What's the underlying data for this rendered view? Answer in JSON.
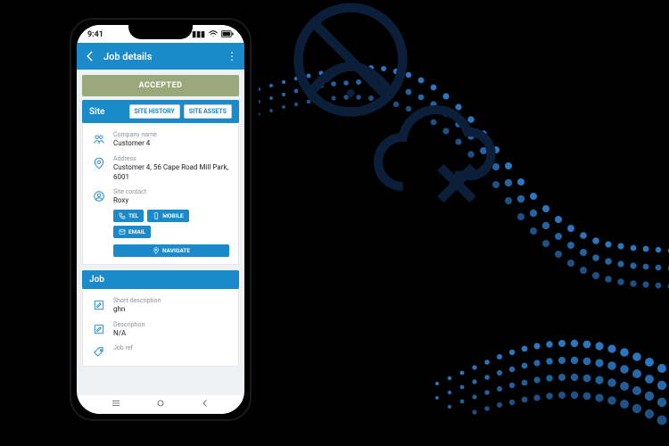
{
  "colors": {
    "primary": "#1a8acb",
    "accepted": "#9aa97c",
    "icon_dark": "#0b1f3a"
  },
  "status_bar": {
    "time": "9:41"
  },
  "header": {
    "title": "Job details"
  },
  "job_status": {
    "label": "ACCEPTED"
  },
  "site": {
    "section_label": "Site",
    "buttons": {
      "history": "SITE HISTORY",
      "assets": "SITE ASSETS"
    },
    "company": {
      "label": "Company name",
      "value": "Customer 4"
    },
    "address": {
      "label": "Address",
      "value": "Customer 4, 56 Cape Road Mill Park, 6001"
    },
    "contact": {
      "label": "Site contact",
      "value": "Roxy"
    },
    "actions": {
      "tel": "TEL",
      "mobile": "MOBILE",
      "email": "EMAIL",
      "navigate": "NAVIGATE"
    }
  },
  "job": {
    "section_label": "Job",
    "short_description": {
      "label": "Short description",
      "value": "ghn"
    },
    "description": {
      "label": "Description",
      "value": "N/A"
    },
    "ref": {
      "label": "Job ref"
    }
  }
}
